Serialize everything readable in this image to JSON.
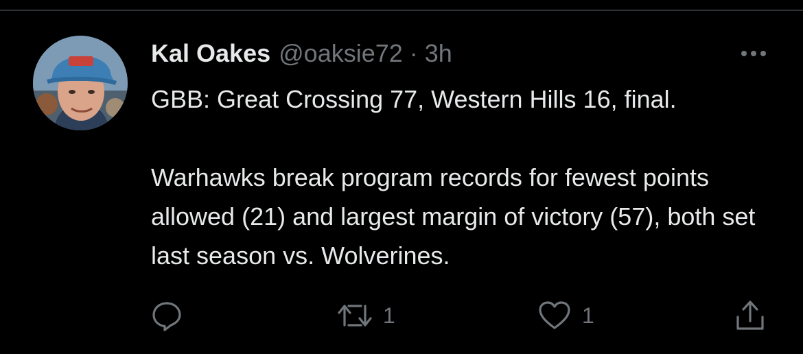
{
  "tweet": {
    "author": {
      "display_name": "Kal Oakes",
      "handle": "@oaksie72"
    },
    "separator": "·",
    "timestamp": "3h",
    "text_lines": [
      "GBB: Great Crossing 77, Western Hills 16, final.",
      "Warhawks break program records for fewest points allowed (21) and largest margin of victory (57), both set last season vs. Wolverines."
    ],
    "actions": {
      "reply_icon": "reply-icon",
      "retweet_icon": "retweet-icon",
      "retweet_count": "1",
      "like_icon": "heart-icon",
      "like_count": "1",
      "share_icon": "share-icon"
    }
  },
  "colors": {
    "background": "#000000",
    "primary_text": "#e7e9ea",
    "secondary_text": "#71767b",
    "divider": "#2f3336"
  }
}
